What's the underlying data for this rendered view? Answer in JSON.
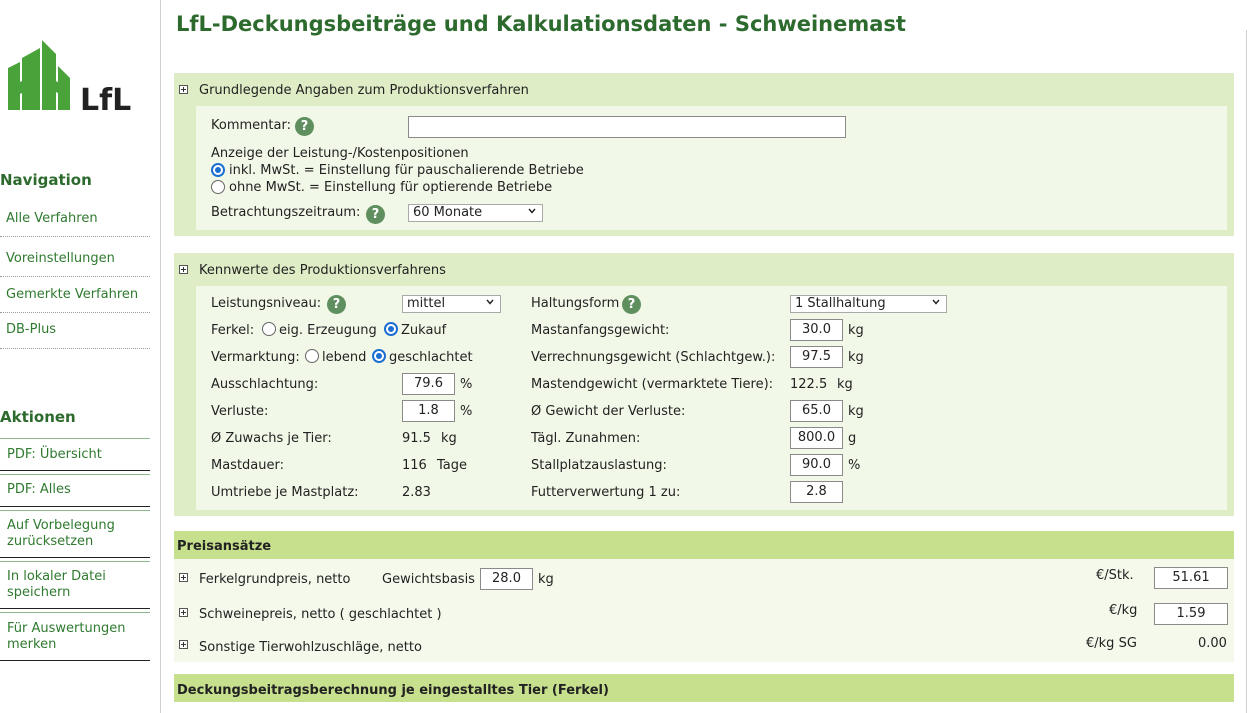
{
  "page": {
    "title": "LfL-Deckungsbeiträge und Kalkulationsdaten - Schweinemast"
  },
  "logo": {
    "text": "LfL"
  },
  "colors": {
    "brand_green": "#2d6a2d",
    "panel_bg": "#dfedc6",
    "inner_bg": "#f2f8e8",
    "bar_bg": "#c6e08e",
    "radio_selected": "#1a6fd1"
  },
  "sidebar": {
    "nav_heading": "Navigation",
    "nav_items": [
      "Alle Verfahren",
      "Voreinstellungen",
      "Gemerkte Verfahren",
      "DB-Plus"
    ],
    "actions_heading": "Aktionen",
    "actions": [
      [
        "PDF: Übersicht"
      ],
      [
        "PDF: Alles"
      ],
      [
        "Auf Vorbelegung",
        "zurücksetzen"
      ],
      [
        "In lokaler Datei",
        "speichern"
      ],
      [
        "Für Auswertungen",
        "merken"
      ]
    ]
  },
  "grund": {
    "header": "Grundlegende Angaben zum Produktionsverfahren",
    "kommentar_label": "Kommentar:",
    "kommentar_value": "",
    "anzeige_label": "Anzeige der Leistung-/Kostenpositionen",
    "radio_inkl": "inkl. MwSt. = Einstellung für pauschalierende Betriebe",
    "radio_ohne": "ohne MwSt. = Einstellung für optierende Betriebe",
    "zeitraum_label": "Betrachtungszeitraum:",
    "zeitraum_value": "60 Monate"
  },
  "kenn": {
    "header": "Kennwerte des Produktionsverfahrens",
    "leistung_label": "Leistungsniveau:",
    "leistung_value": "mittel",
    "haltung_label": "Haltungsform",
    "haltung_value": "1 Stallhaltung",
    "ferkel_label": "Ferkel:",
    "ferkel_opt1": "eig. Erzeugung",
    "ferkel_opt2": "Zukauf",
    "vermarktung_label": "Vermarktung:",
    "vermarktung_opt1": "lebend",
    "vermarktung_opt2": "geschlachtet",
    "ausschlachtung_label": "Ausschlachtung:",
    "ausschlachtung_value": "79.6",
    "ausschlachtung_unit": "%",
    "verluste_label": "Verluste:",
    "verluste_value": "1.8",
    "verluste_unit": "%",
    "zuwachs_label": "Ø Zuwachs je Tier:",
    "zuwachs_value": "91.5",
    "zuwachs_unit": "kg",
    "mastdauer_label": "Mastdauer:",
    "mastdauer_value": "116",
    "mastdauer_unit": "Tage",
    "umtriebe_label": "Umtriebe je Mastplatz:",
    "umtriebe_value": "2.83",
    "mastanfang_label": "Mastanfangsgewicht:",
    "mastanfang_value": "30.0",
    "mastanfang_unit": "kg",
    "verrechnung_label": "Verrechnungsgewicht (Schlachtgew.):",
    "verrechnung_value": "97.5",
    "verrechnung_unit": "kg",
    "mastend_label": "Mastendgewicht (vermarktete Tiere):",
    "mastend_value": "122.5",
    "mastend_unit": "kg",
    "gewverl_label": "Ø Gewicht der Verluste:",
    "gewverl_value": "65.0",
    "gewverl_unit": "kg",
    "zunahmen_label": "Tägl. Zunahmen:",
    "zunahmen_value": "800.0",
    "zunahmen_unit": "g",
    "auslastung_label": "Stallplatzauslastung:",
    "auslastung_value": "90.0",
    "auslastung_unit": "%",
    "futter_label": "Futterverwertung 1 zu:",
    "futter_value": "2.8"
  },
  "preis": {
    "header": "Preisansätze",
    "ferkel_label": "Ferkelgrundpreis, netto",
    "gewichtsbasis_label": "Gewichtsbasis",
    "gewichtsbasis_value": "28.0",
    "gewichtsbasis_unit": "kg",
    "ferkel_unit": "€/Stk.",
    "ferkel_value": "51.61",
    "schwein_label": "Schweinepreis, netto ( geschlachtet )",
    "schwein_unit": "€/kg",
    "schwein_value": "1.59",
    "tierwohl_label": "Sonstige Tierwohlzuschläge, netto",
    "tierwohl_unit": "€/kg SG",
    "tierwohl_value": "0.00"
  },
  "db": {
    "header": "Deckungsbeitragsberechnung je eingestalltes Tier (Ferkel)"
  }
}
